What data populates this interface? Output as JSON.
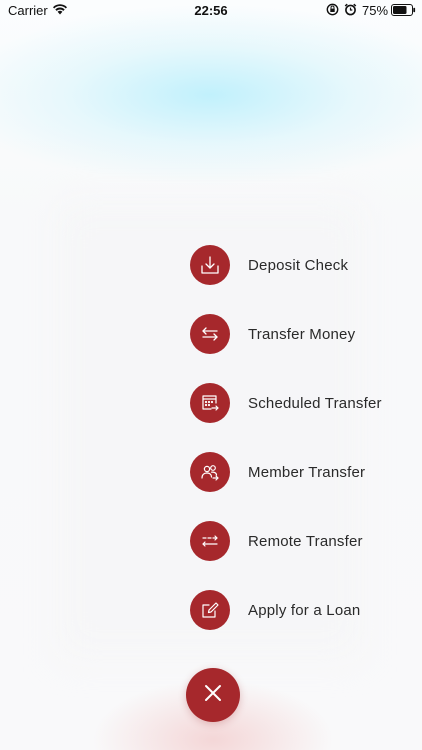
{
  "status_bar": {
    "carrier": "Carrier",
    "time": "22:56",
    "battery_percent": "75%",
    "battery_level": 0.75
  },
  "actions": [
    {
      "label": "Deposit Check",
      "icon": "deposit-icon"
    },
    {
      "label": "Transfer Money",
      "icon": "transfer-arrows-icon"
    },
    {
      "label": "Scheduled Transfer",
      "icon": "calendar-transfer-icon"
    },
    {
      "label": "Member Transfer",
      "icon": "members-icon"
    },
    {
      "label": "Remote Transfer",
      "icon": "remote-transfer-icon"
    },
    {
      "label": "Apply for a Loan",
      "icon": "edit-icon"
    }
  ],
  "close_button": {
    "icon": "close-icon"
  },
  "colors": {
    "accent": "#a6282c",
    "text": "#2a2a2a"
  }
}
